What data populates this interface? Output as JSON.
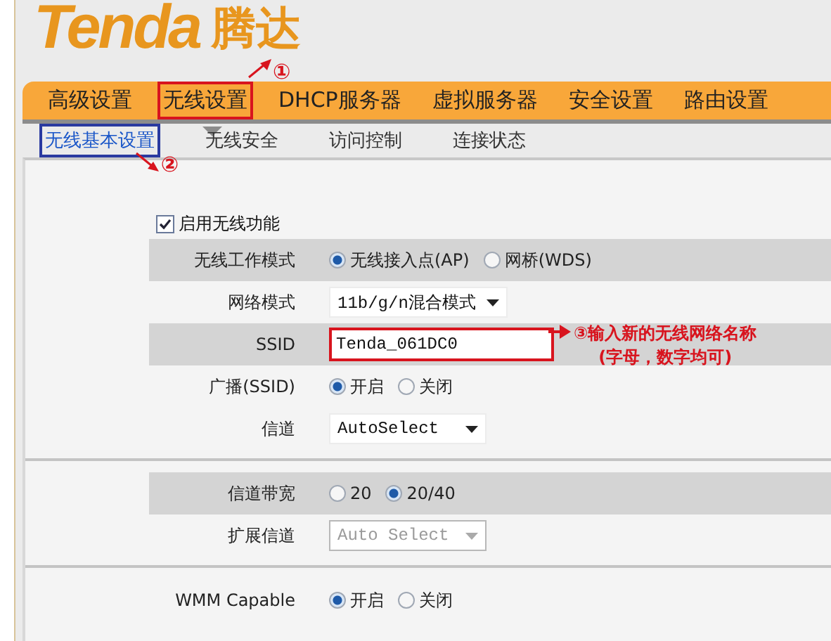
{
  "logo": {
    "brand": "Tenda",
    "native": "腾达"
  },
  "nav": {
    "items": [
      {
        "label": "高级设置",
        "selected": false
      },
      {
        "label": "无线设置",
        "selected": true,
        "annotation": "①"
      },
      {
        "label": "DHCP服务器",
        "selected": false
      },
      {
        "label": "虚拟服务器",
        "selected": false
      },
      {
        "label": "安全设置",
        "selected": false
      },
      {
        "label": "路由设置",
        "selected": false
      }
    ]
  },
  "subtabs": [
    {
      "label": "无线基本设置",
      "selected": true,
      "annotation": "②"
    },
    {
      "label": "无线安全",
      "selected": false
    },
    {
      "label": "访问控制",
      "selected": false
    },
    {
      "label": "连接状态",
      "selected": false
    }
  ],
  "enable": {
    "label": "启用无线功能",
    "checked": true
  },
  "sections": [
    {
      "rows": [
        {
          "kind": "radio",
          "label": "无线工作模式",
          "shaded": true,
          "options": [
            {
              "label": "无线接入点(AP)",
              "selected": true
            },
            {
              "label": "网桥(WDS)",
              "selected": false
            }
          ]
        },
        {
          "kind": "select",
          "label": "网络模式",
          "shaded": false,
          "value": "11b/g/n混合模式",
          "disabled": false
        },
        {
          "kind": "text",
          "label": "SSID",
          "shaded": true,
          "value": "Tenda_061DC0",
          "callout": {
            "number": "③",
            "lines": [
              "输入新的无线网络名称",
              "(字母，数字均可)"
            ]
          }
        },
        {
          "kind": "radio",
          "label": "广播(SSID)",
          "shaded": false,
          "options": [
            {
              "label": "开启",
              "selected": true
            },
            {
              "label": "关闭",
              "selected": false
            }
          ]
        },
        {
          "kind": "select",
          "label": "信道",
          "shaded": false,
          "value": "AutoSelect",
          "disabled": false
        }
      ]
    },
    {
      "rows": [
        {
          "kind": "radio",
          "label": "信道带宽",
          "shaded": true,
          "options": [
            {
              "label": "20",
              "selected": false
            },
            {
              "label": "20/40",
              "selected": true
            }
          ]
        },
        {
          "kind": "select",
          "label": "扩展信道",
          "shaded": false,
          "value": "Auto Select",
          "disabled": true
        }
      ]
    },
    {
      "rows": [
        {
          "kind": "radio",
          "label": "WMM Capable",
          "shaded": false,
          "options": [
            {
              "label": "开启",
              "selected": true
            },
            {
              "label": "关闭",
              "selected": false
            }
          ]
        }
      ]
    }
  ]
}
